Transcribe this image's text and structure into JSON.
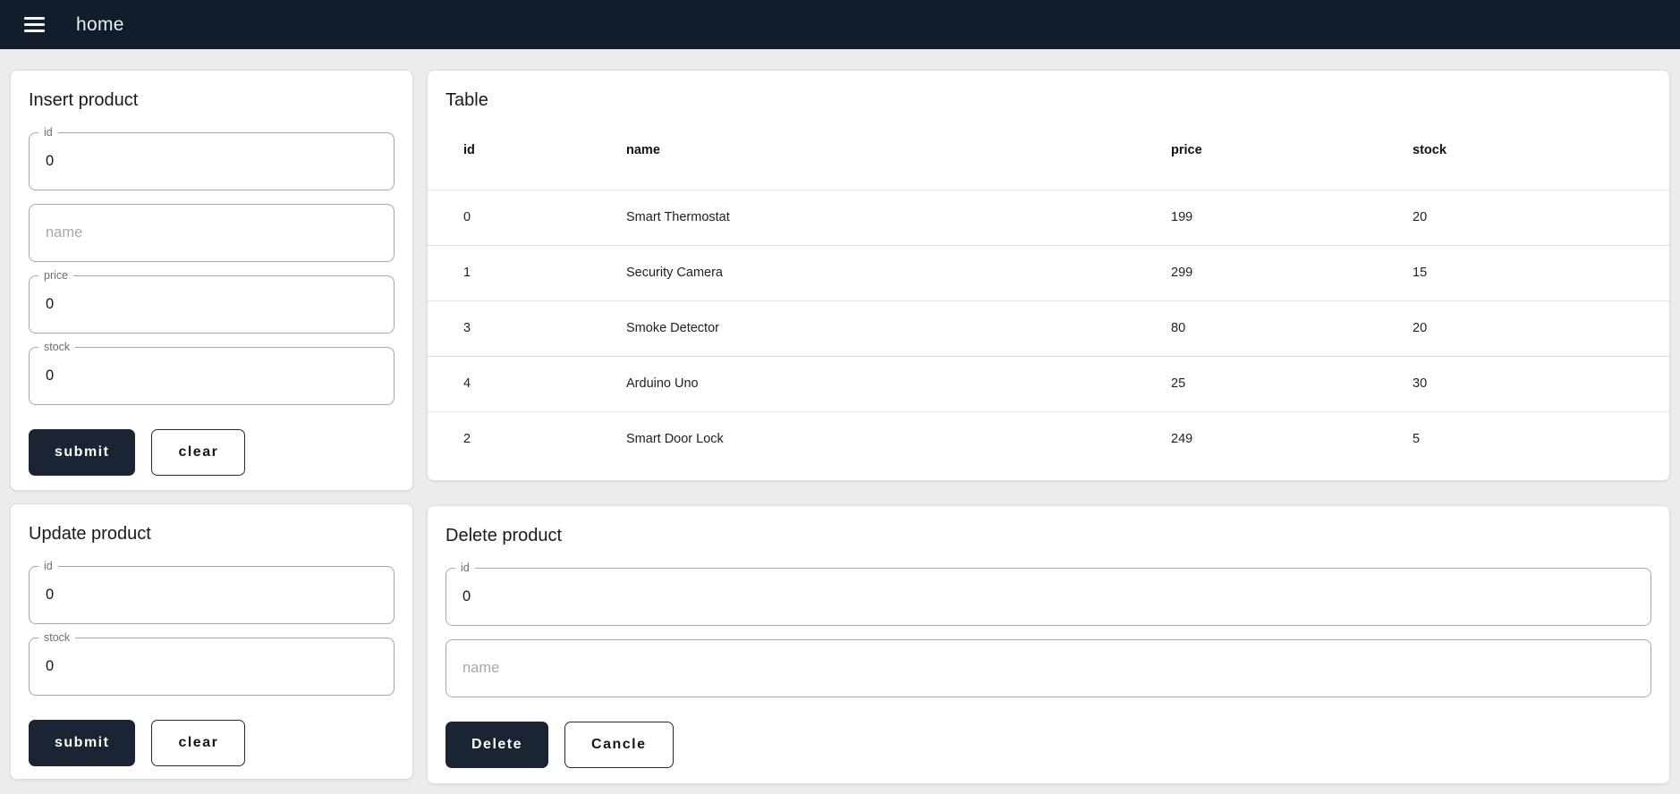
{
  "appbar": {
    "title": "home"
  },
  "insert": {
    "title": "Insert product",
    "id_label": "id",
    "id_value": "0",
    "name_placeholder": "name",
    "price_label": "price",
    "price_value": "0",
    "stock_label": "stock",
    "stock_value": "0",
    "submit_label": "submit",
    "clear_label": "clear"
  },
  "table": {
    "title": "Table",
    "columns": [
      "id",
      "name",
      "price",
      "stock"
    ],
    "rows": [
      [
        "0",
        "Smart Thermostat",
        "199",
        "20"
      ],
      [
        "1",
        "Security Camera",
        "299",
        "15"
      ],
      [
        "3",
        "Smoke Detector",
        "80",
        "20"
      ],
      [
        "4",
        "Arduino Uno",
        "25",
        "30"
      ],
      [
        "2",
        "Smart Door Lock",
        "249",
        "5"
      ]
    ]
  },
  "update": {
    "title": "Update product",
    "id_label": "id",
    "id_value": "0",
    "stock_label": "stock",
    "stock_value": "0",
    "submit_label": "submit",
    "clear_label": "clear"
  },
  "delete": {
    "title": "Delete product",
    "id_label": "id",
    "id_value": "0",
    "name_placeholder": "name",
    "delete_label": "Delete",
    "cancel_label": "Cancle"
  },
  "colors": {
    "appbar_bg": "#121d2b",
    "page_bg": "#ececec",
    "primary_button_bg": "#1a2433",
    "divider": "#e0e0e0"
  }
}
